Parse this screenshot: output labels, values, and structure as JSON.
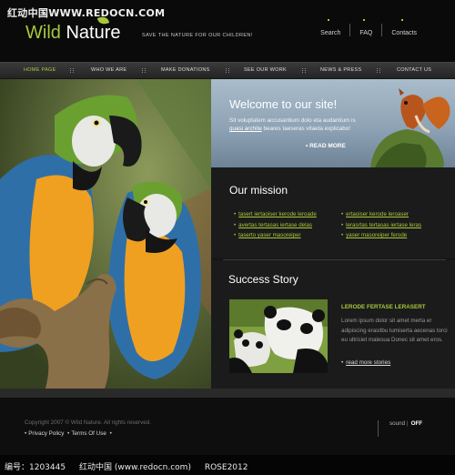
{
  "watermark": {
    "top": "红动中国WWW.REDOCN.COM",
    "bottom": [
      "编号：1203445",
      "红动中国 (www.redocn.com)",
      "ROSE2012"
    ]
  },
  "brand": {
    "wild": "Wild",
    "nature": "Nature",
    "tagline": "SAVE THE NATURE FOR OUR CHILDREN!"
  },
  "top_nav": [
    "Search",
    "FAQ",
    "Contacts"
  ],
  "main_nav": [
    "HOME PAGE",
    "WHO WE ARE",
    "MAKE DONATIONS",
    "SEE OUR WORK",
    "NEWS & PRESS",
    "CONTACT US"
  ],
  "welcome": {
    "title": "Welcome to our site!",
    "text_a": "Sit voluptatem accusantium dolo eta audantium is ",
    "link": "quasi archite",
    "text_b": " beares taeseras vitaeta explicabo!",
    "more": "READ MORE"
  },
  "mission": {
    "title": "Our mission",
    "left": [
      "tasert iertaoiser kerode leroade",
      "avertas tertasas iertase delas",
      "taserto yaser masoreiper"
    ],
    "right": [
      "ertaoiser kerode leroaser",
      "lerasrtas tertasas iertase leras",
      "yaser masoreiper ferode"
    ]
  },
  "story": {
    "title": "Success Story",
    "heading": "LERODE FERTASE LERASERT",
    "text": "Lorem ipsum dolor sit amet merta er adipiscing erasitbu lumiserta aecenas torci eu ultriciet malesua Donec sit amet eros.",
    "more": "read more stories"
  },
  "footer": {
    "copyright": "Copyright 2007 © Wild Nature. All rights reserved.",
    "privacy": "Privacy Policy",
    "terms": "Terms Of Use",
    "sound_label": "sound",
    "sound_state": "OFF"
  },
  "colors": {
    "accent": "#a8c83a",
    "background": "#151515",
    "welcome_bg": "#9aafc1"
  }
}
